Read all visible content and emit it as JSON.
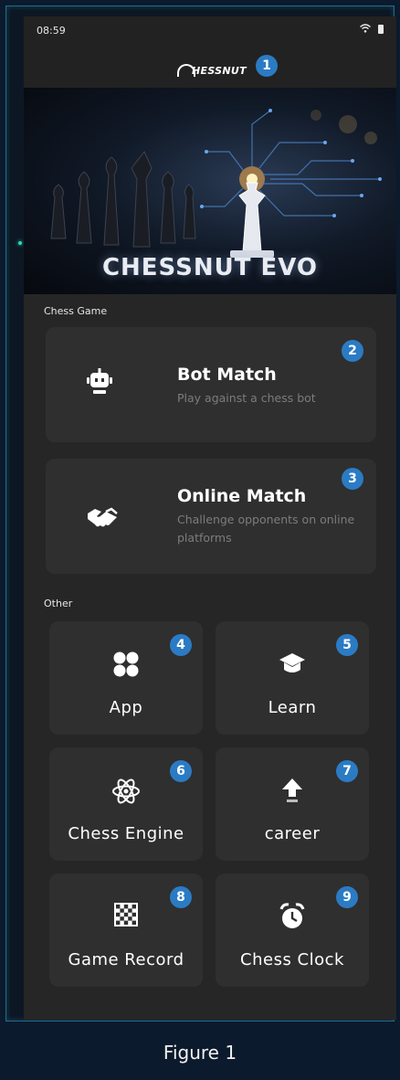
{
  "status_bar": {
    "time": "08:59"
  },
  "header": {
    "logo_text": "HESSNUT",
    "badge": "1"
  },
  "hero": {
    "title": "CHESSNUT EVO"
  },
  "chess_game": {
    "section_label": "Chess Game",
    "bot_match": {
      "title": "Bot Match",
      "description": "Play against a chess bot",
      "badge": "2",
      "icon": "robot-icon"
    },
    "online_match": {
      "title": "Online Match",
      "description": "Challenge opponents on online platforms",
      "badge": "3",
      "icon": "handshake-icon"
    }
  },
  "other": {
    "section_label": "Other",
    "tiles": [
      {
        "label": "App",
        "badge": "4",
        "icon": "app-grid-icon"
      },
      {
        "label": "Learn",
        "badge": "5",
        "icon": "graduation-cap-icon"
      },
      {
        "label": "Chess Engine",
        "badge": "6",
        "icon": "atom-icon"
      },
      {
        "label": "career",
        "badge": "7",
        "icon": "elo-arrow-icon"
      },
      {
        "label": "Game Record",
        "badge": "8",
        "icon": "checkerboard-icon"
      },
      {
        "label": "Chess Clock",
        "badge": "9",
        "icon": "alarm-clock-icon"
      }
    ]
  },
  "colors": {
    "badge": "#2b7bc4",
    "card": "#2f2f2f",
    "panel": "#262626",
    "frame": "#0d1724"
  },
  "caption": "Figure 1"
}
